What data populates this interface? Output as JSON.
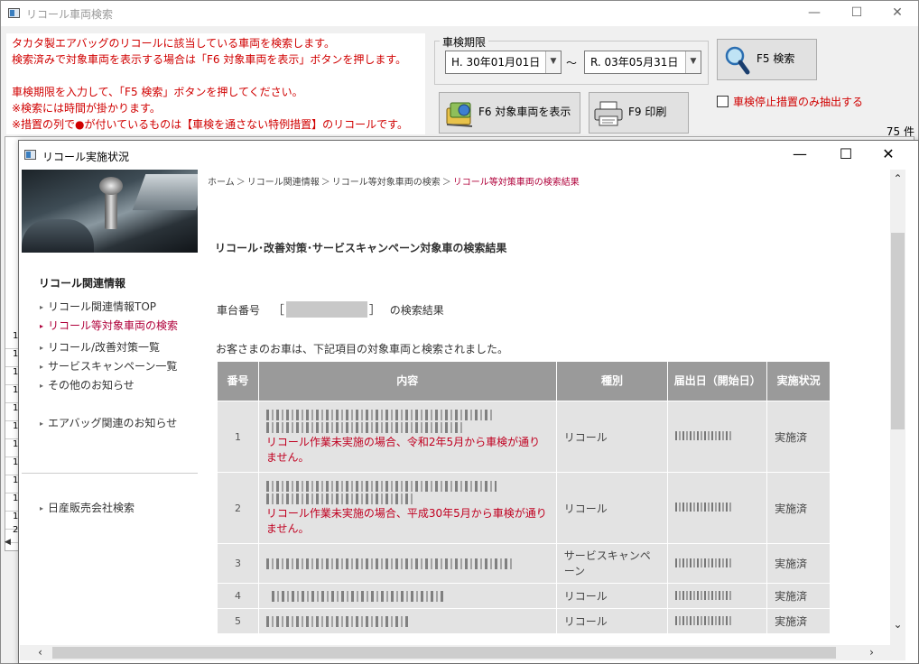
{
  "main_window": {
    "title": "リコール車両検索",
    "notice_lines": [
      "タカタ製エアバッグのリコールに該当している車両を検索します。",
      "検索済みで対象車両を表示する場合は「F6 対象車両を表示」ボタンを押します。",
      "",
      "車検期限を入力して、「F5 検索」ボタンを押してください。",
      "※検索には時間が掛かります。",
      "※措置の列で●が付いているものは【車検を通さない特例措置】のリコールです。"
    ],
    "period_label": "車検期限",
    "date_from": "H. 30年01月01日",
    "date_to": "R. 03年05月31日",
    "tilde": "～",
    "search_button": "F5 検索",
    "show_button": "F6 対象車両を表示",
    "print_button": "F9 印刷",
    "checkbox_label": "車検停止措置のみ抽出する",
    "record_count": "75 件",
    "bg_rows": [
      "1",
      "1",
      "1",
      "1",
      "1",
      "1",
      "1",
      "1",
      "1",
      "1",
      "1",
      "2"
    ]
  },
  "dialog": {
    "title": "リコール実施状況",
    "breadcrumb": [
      "ホーム",
      "リコール関連情報",
      "リコール等対象車両の検索",
      "リコール等対策車両の検索結果"
    ],
    "sidebar_heading": "リコール関連情報",
    "sidebar_items": [
      {
        "label": "リコール関連情報TOP"
      },
      {
        "label": "リコール等対象車両の検索"
      },
      {
        "label": "リコール/改善対策一覧"
      },
      {
        "label": "サービスキャンペーン一覧"
      },
      {
        "label": "その他のお知らせ"
      },
      {
        "label": "エアバッグ関連のお知らせ"
      },
      {
        "label": "日産販売会社検索"
      }
    ],
    "page_title": "リコール･改善対策･サービスキャンペーン対象車の検索結果",
    "vin_prefix": "車台番号",
    "vin_open": "［",
    "vin_close": "］",
    "vin_suffix": "の検索結果",
    "found_text": "お客さまのお車は、下記項目の対象車両と検索されました。",
    "table_headers": [
      "番号",
      "内容",
      "種別",
      "届出日（開始日）",
      "実施状況"
    ],
    "rows": [
      {
        "no": "1",
        "note": "リコール作業未実施の場合、令和2年5月から車検が通りません。",
        "type": "リコール",
        "status": "実施済"
      },
      {
        "no": "2",
        "note": "リコール作業未実施の場合、平成30年5月から車検が通りません。",
        "type": "リコール",
        "status": "実施済"
      },
      {
        "no": "3",
        "note": "",
        "type": "サービスキャンペーン",
        "status": "実施済"
      },
      {
        "no": "4",
        "note": "",
        "type": "リコール",
        "status": "実施済"
      },
      {
        "no": "5",
        "note": "",
        "type": "リコール",
        "status": "実施済"
      }
    ]
  }
}
